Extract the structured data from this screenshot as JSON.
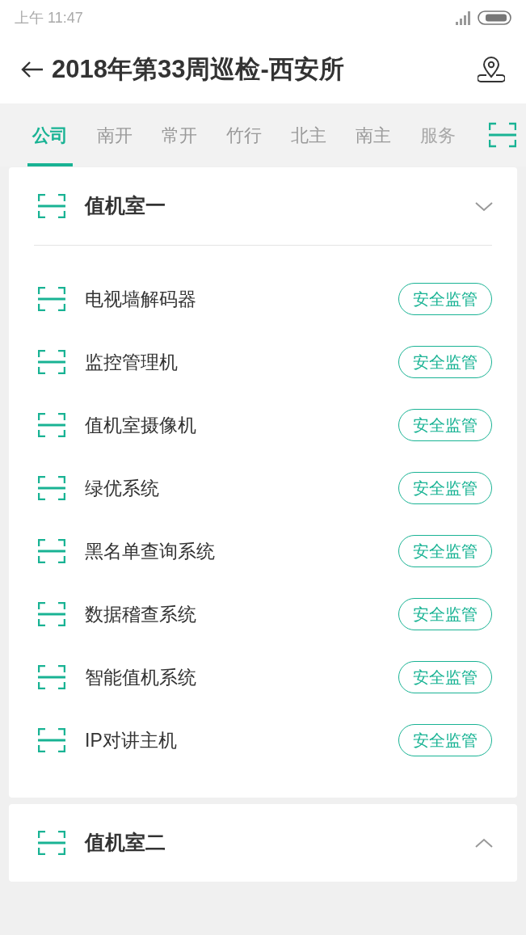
{
  "status_bar": {
    "time": "上午 11:47"
  },
  "header": {
    "title": "2018年第33周巡检-西安所"
  },
  "tabs": [
    {
      "label": "公司",
      "selected": true
    },
    {
      "label": "南开",
      "selected": false
    },
    {
      "label": "常开",
      "selected": false
    },
    {
      "label": "竹行",
      "selected": false
    },
    {
      "label": "北主",
      "selected": false
    },
    {
      "label": "南主",
      "selected": false
    },
    {
      "label": "服务",
      "selected": false
    }
  ],
  "sections": [
    {
      "title": "值机室一",
      "expanded": true,
      "items": [
        {
          "name": "电视墙解码器",
          "tag": "安全监管"
        },
        {
          "name": "监控管理机",
          "tag": "安全监管"
        },
        {
          "name": "值机室摄像机",
          "tag": "安全监管"
        },
        {
          "name": "绿优系统",
          "tag": "安全监管"
        },
        {
          "name": "黑名单查询系统",
          "tag": "安全监管"
        },
        {
          "name": "数据稽查系统",
          "tag": "安全监管"
        },
        {
          "name": "智能值机系统",
          "tag": "安全监管"
        },
        {
          "name": "IP对讲主机",
          "tag": "安全监管"
        }
      ]
    },
    {
      "title": "值机室二",
      "expanded": false
    }
  ]
}
